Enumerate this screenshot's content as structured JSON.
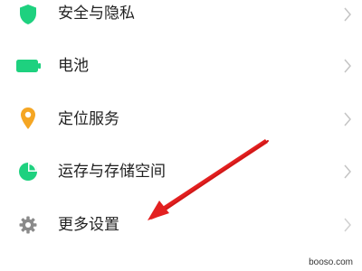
{
  "settings": {
    "items": [
      {
        "label": "安全与隐私",
        "icon": "shield-icon",
        "icon_color": "#1ED17F"
      },
      {
        "label": "电池",
        "icon": "battery-icon",
        "icon_color": "#1ED17F"
      },
      {
        "label": "定位服务",
        "icon": "location-pin-icon",
        "icon_color": "#F5A623"
      },
      {
        "label": "运存与存储空间",
        "icon": "pie-chart-icon",
        "icon_color": "#1ED17F"
      },
      {
        "label": "更多设置",
        "icon": "gear-icon",
        "icon_color": "#8A8A8A"
      }
    ]
  },
  "annotation": {
    "arrow_color": "#E32020"
  },
  "watermark": {
    "text": "booso.com"
  }
}
